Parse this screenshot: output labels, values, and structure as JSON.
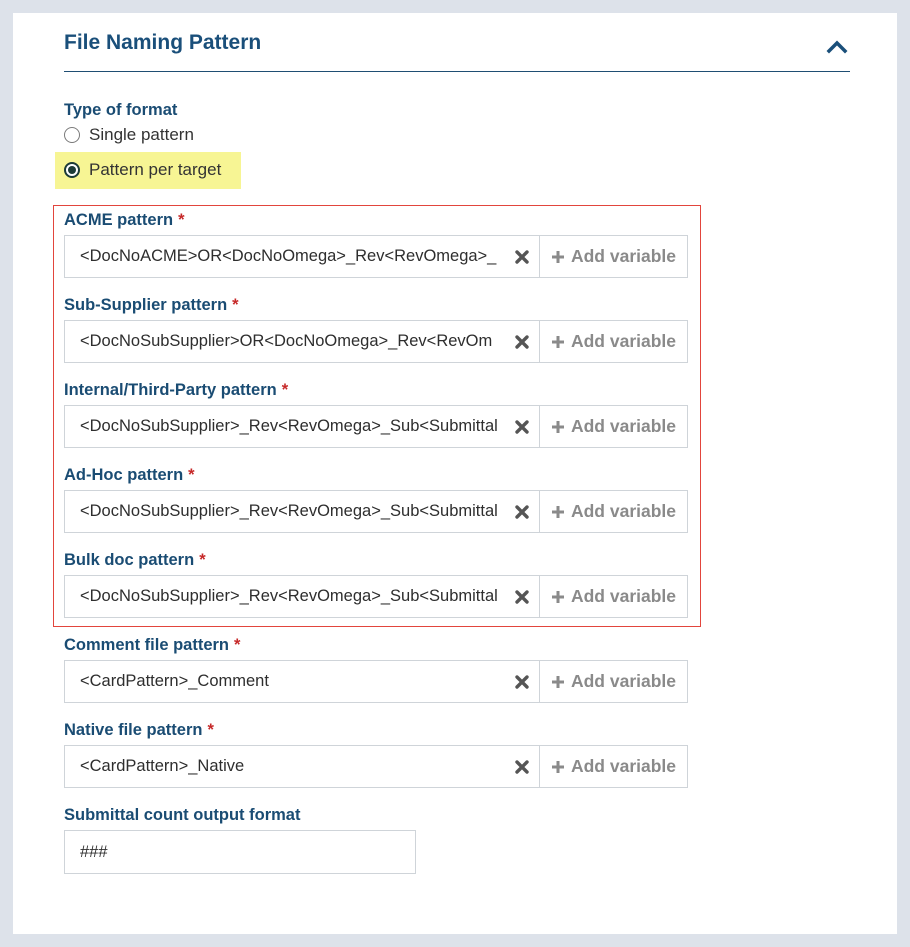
{
  "section": {
    "title": "File Naming Pattern"
  },
  "format": {
    "label": "Type of format",
    "options": [
      {
        "label": "Single pattern",
        "checked": false
      },
      {
        "label": "Pattern per target",
        "checked": true
      }
    ]
  },
  "required_marker": "*",
  "add_variable_label": "Add variable",
  "patterns": [
    {
      "label": "ACME pattern",
      "value": "<DocNoACME>OR<DocNoOmega>_Rev<RevOmega>_"
    },
    {
      "label": "Sub-Supplier pattern",
      "value": "<DocNoSubSupplier>OR<DocNoOmega>_Rev<RevOm"
    },
    {
      "label": "Internal/Third-Party pattern",
      "value": "<DocNoSubSupplier>_Rev<RevOmega>_Sub<Submittal"
    },
    {
      "label": "Ad-Hoc pattern",
      "value": "<DocNoSubSupplier>_Rev<RevOmega>_Sub<Submittal"
    },
    {
      "label": "Bulk doc pattern",
      "value": "<DocNoSubSupplier>_Rev<RevOmega>_Sub<Submittal"
    },
    {
      "label": "Comment file pattern",
      "value": "<CardPattern>_Comment"
    },
    {
      "label": "Native file pattern",
      "value": "<CardPattern>_Native"
    }
  ],
  "submittal": {
    "label": "Submittal count output format",
    "value": "###"
  },
  "colors": {
    "accent": "#1a4f7a",
    "required": "#c62828",
    "highlight": "#f7f594",
    "outline": "#e2453d"
  }
}
